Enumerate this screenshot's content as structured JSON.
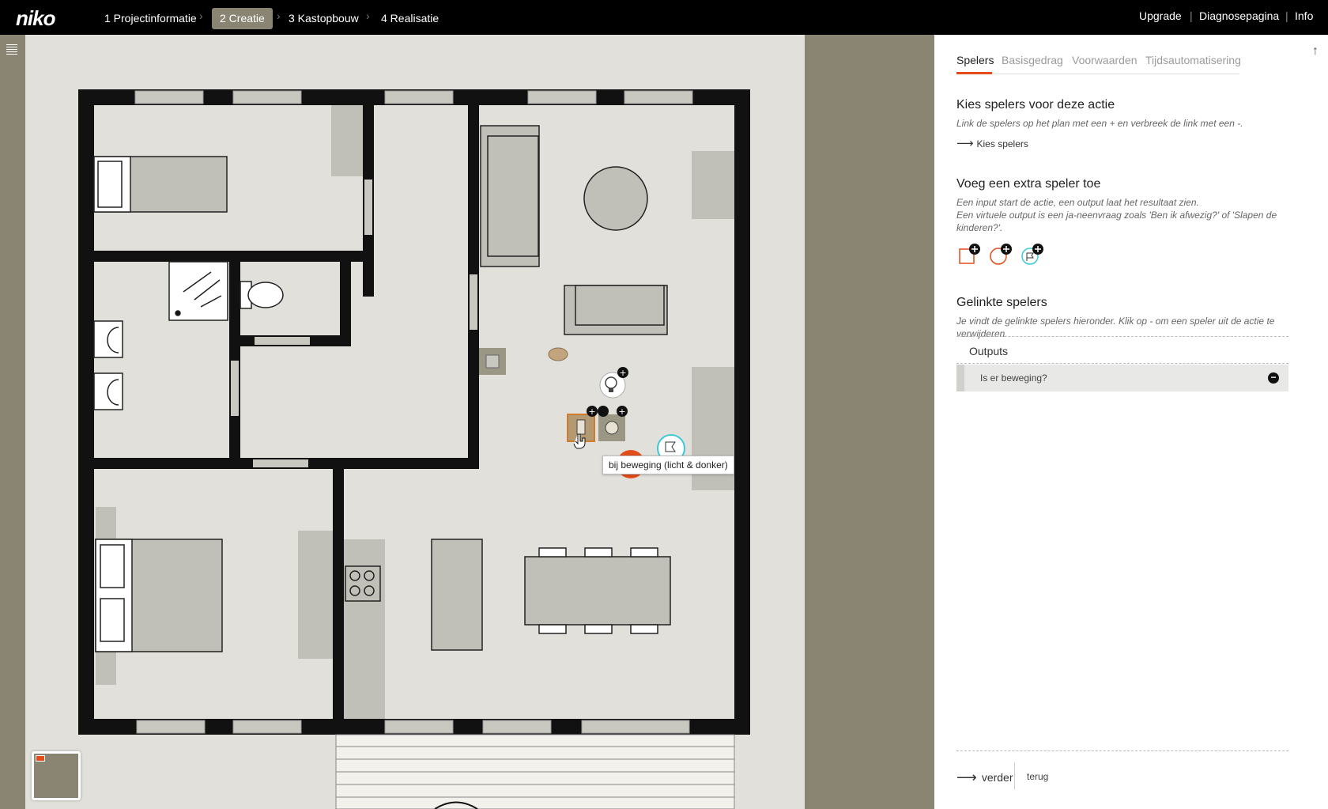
{
  "topbar": {
    "logo": "niko",
    "steps": [
      {
        "label": "1 Projectinformatie",
        "active": false
      },
      {
        "label": "2 Creatie",
        "active": true
      },
      {
        "label": "3 Kastopbouw",
        "active": false
      },
      {
        "label": "4 Realisatie",
        "active": false
      }
    ],
    "links": [
      "Upgrade",
      "Diagnosepagina",
      "Info"
    ]
  },
  "canvas": {
    "tooltip": "bij beweging (licht & donker)"
  },
  "panel": {
    "tabs": [
      "Spelers",
      "Basisgedrag",
      "Voorwaarden",
      "Tijdsautomatisering"
    ],
    "active_tab": "Spelers",
    "section_choose": {
      "title": "Kies spelers voor deze actie",
      "description": "Link de spelers op het plan met een + en verbreek de link met een -.",
      "link": "Kies spelers"
    },
    "section_add": {
      "title": "Voeg een extra speler toe",
      "description_line1": "Een input start de actie, een output laat het resultaat zien.",
      "description_line2": "Een virtuele output is een ja-neenvraag zoals 'Ben ik afwezig?' of 'Slapen de kinderen?'.",
      "players": [
        {
          "icon": "input-square-icon",
          "color": "#e44d1a"
        },
        {
          "icon": "output-circle-icon",
          "color": "#e44d1a"
        },
        {
          "icon": "virtual-output-flag-icon",
          "color": "#3cc8d8"
        }
      ]
    },
    "section_linked": {
      "title": "Gelinkte spelers",
      "description": "Je vindt de gelinkte spelers hieronder. Klik op - om een speler uit de actie te verwijderen.",
      "group_label": "Outputs",
      "items": [
        "Is er beweging?"
      ]
    },
    "footer": {
      "next": "verder",
      "back": "terug"
    }
  },
  "colors": {
    "accent": "#e44d1a",
    "frame": "#8a8472",
    "floor": "#e1e0da",
    "wall": "#111111",
    "furniture": "#c1c0b8",
    "virtual": "#3cc8d8"
  }
}
